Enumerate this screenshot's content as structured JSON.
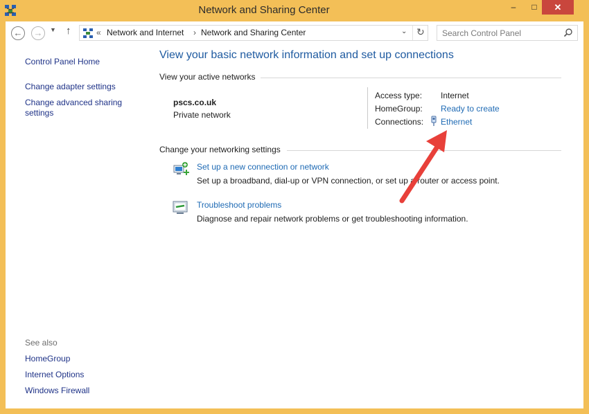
{
  "window": {
    "title": "Network and Sharing Center",
    "icons": {
      "app": "network-icon",
      "minimize": "minimize-icon",
      "maximize": "maximize-icon",
      "close": "close-icon"
    },
    "minimize_glyph": "–",
    "maximize_glyph": "□",
    "close_glyph": "✕"
  },
  "navbar": {
    "back_glyph": "←",
    "forward_glyph": "→",
    "recent_glyph": "▼",
    "up_glyph": "↑",
    "breadcrumb_overflow": "«",
    "breadcrumbs": [
      "Network and Internet",
      "Network and Sharing Center"
    ],
    "breadcrumb_separator": "›",
    "dropdown_glyph": "⌄",
    "refresh_glyph": "↻",
    "search_placeholder": "Search Control Panel"
  },
  "sidebar": {
    "home": "Control Panel Home",
    "links": [
      "Change adapter settings",
      "Change advanced sharing settings"
    ],
    "see_also_label": "See also",
    "see_also": [
      "HomeGroup",
      "Internet Options",
      "Windows Firewall"
    ]
  },
  "main": {
    "title": "View your basic network information and set up connections",
    "active_networks_heading": "View your active networks",
    "network": {
      "name": "pscs.co.uk",
      "type": "Private network",
      "access_type_label": "Access type:",
      "access_type_value": "Internet",
      "homegroup_label": "HomeGroup:",
      "homegroup_value": "Ready to create",
      "connections_label": "Connections:",
      "connections_value": "Ethernet"
    },
    "settings_heading": "Change your networking settings",
    "tasks": [
      {
        "title": "Set up a new connection or network",
        "description": "Set up a broadband, dial-up or VPN connection, or set up a router or access point.",
        "icon": "new-connection-icon"
      },
      {
        "title": "Troubleshoot problems",
        "description": "Diagnose and repair network problems or get troubleshooting information.",
        "icon": "troubleshoot-icon"
      }
    ]
  },
  "colors": {
    "window_frame": "#f3bf57",
    "link": "#1e6ab4",
    "title": "#1e5aa0",
    "annotation_arrow": "#e8403a"
  }
}
